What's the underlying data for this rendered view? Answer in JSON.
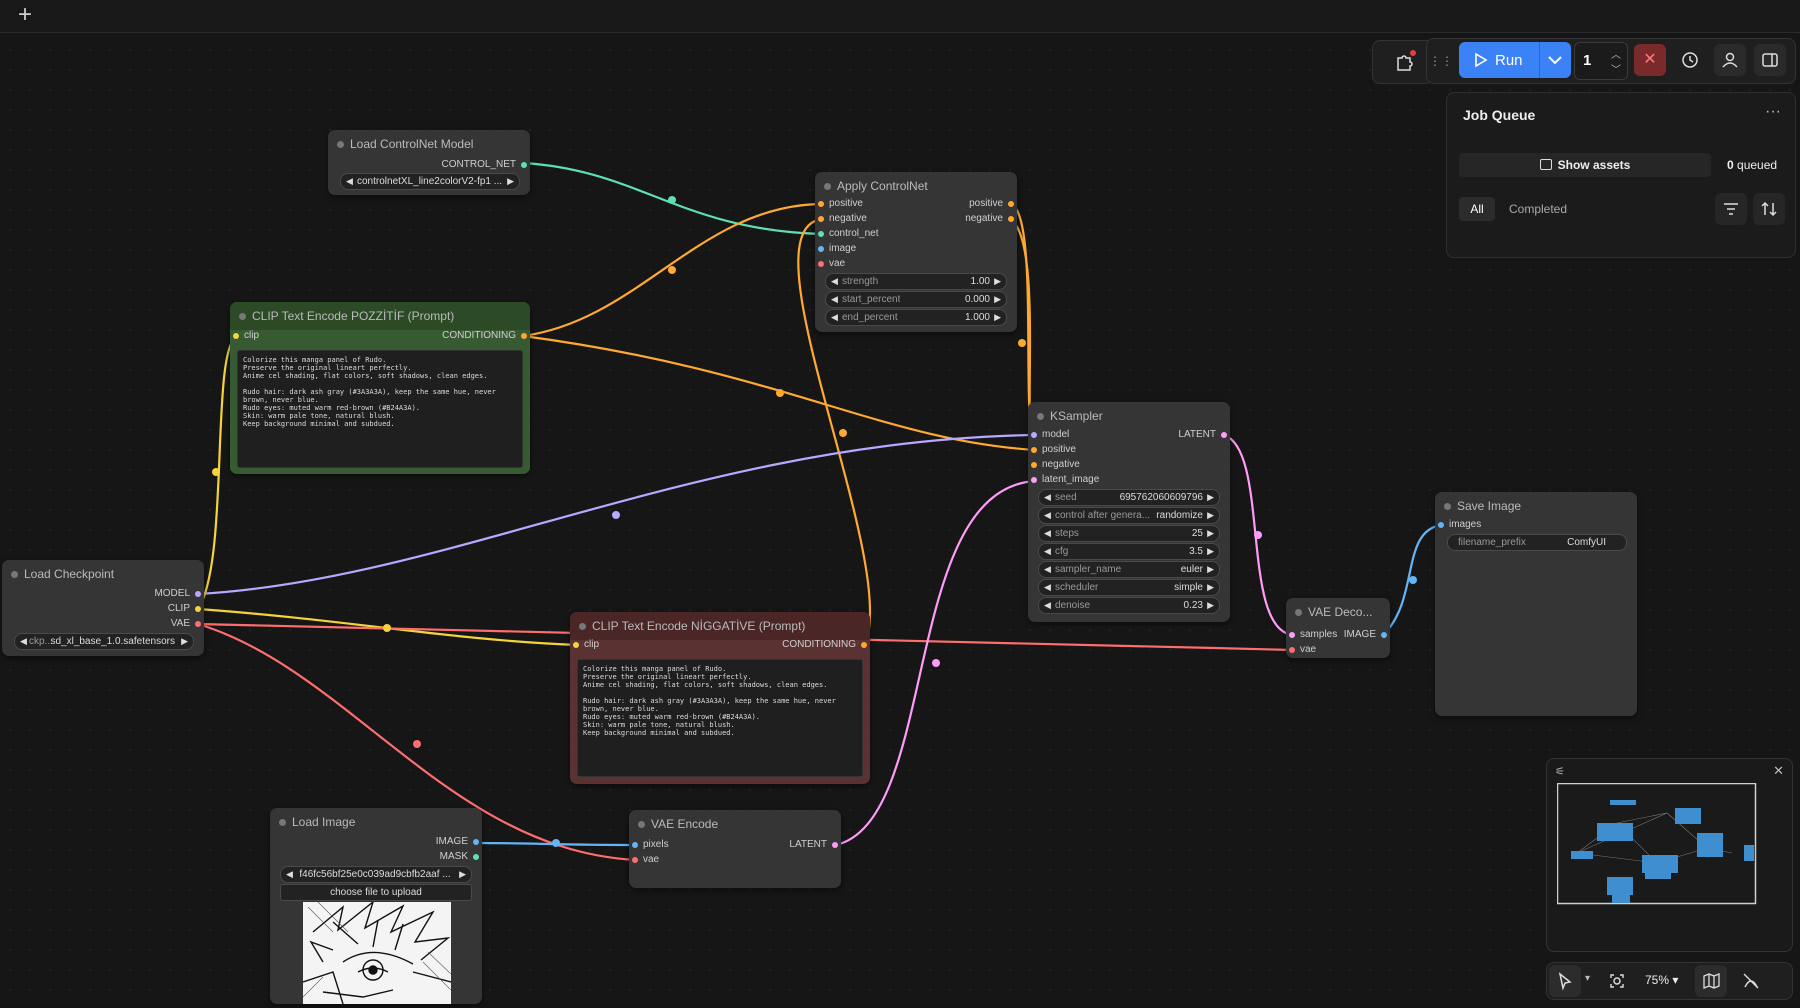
{
  "topbar": {
    "new_tab_icon": "plus-icon"
  },
  "colors": {
    "model": "#b8a8ff",
    "clip": "#f5d33b",
    "vae": "#ff6e6e",
    "conditioning": "#ffa930",
    "control_net": "#5ee0b0",
    "image": "#64b5f6",
    "latent": "#ff9cf9",
    "accent": "#3b82f6"
  },
  "nodes": {
    "load_controlnet": {
      "title": "Load ControlNet Model",
      "out_control_net": "CONTROL_NET",
      "model_name": "controlnetXL_line2colorV2-fp1 ..."
    },
    "apply_controlnet": {
      "title": "Apply ControlNet",
      "in_positive": "positive",
      "in_negative": "negative",
      "in_control_net": "control_net",
      "in_image": "image",
      "in_vae": "vae",
      "out_positive": "positive",
      "out_negative": "negative",
      "strength_label": "strength",
      "strength": "1.00",
      "start_label": "start_percent",
      "start": "0.000",
      "end_label": "end_percent",
      "end": "1.000"
    },
    "clip_pos": {
      "title": "CLIP Text Encode POZZİTİF (Prompt)",
      "in_clip": "clip",
      "out_conditioning": "CONDITIONING",
      "text": "Colorize this manga panel of Rudo.\nPreserve the original lineart perfectly.\nAnime cel shading, flat colors, soft shadows, clean edges.\n\nRudo hair: dark ash gray (#3A3A3A), keep the same hue, never\nbrown, never blue.\nRudo eyes: muted warm red-brown (#B24A3A).\nSkin: warm pale tone, natural blush.\nKeep background minimal and subdued."
    },
    "clip_neg": {
      "title": "CLIP Text Encode NİGGATİVE (Prompt)",
      "in_clip": "clip",
      "out_conditioning": "CONDITIONING",
      "text": "Colorize this manga panel of Rudo.\nPreserve the original lineart perfectly.\nAnime cel shading, flat colors, soft shadows, clean edges.\n\nRudo hair: dark ash gray (#3A3A3A), keep the same hue, never\nbrown, never blue.\nRudo eyes: muted warm red-brown (#B24A3A).\nSkin: warm pale tone, natural blush.\nKeep background minimal and subdued."
    },
    "ksampler": {
      "title": "KSampler",
      "in_model": "model",
      "in_positive": "positive",
      "in_negative": "negative",
      "in_latent": "latent_image",
      "out_latent": "LATENT",
      "seed_label": "seed",
      "seed": "695762060609796",
      "control_label": "control after genera...",
      "control": "randomize",
      "steps_label": "steps",
      "steps": "25",
      "cfg_label": "cfg",
      "cfg": "3.5",
      "sampler_label": "sampler_name",
      "sampler": "euler",
      "scheduler_label": "scheduler",
      "scheduler": "simple",
      "denoise_label": "denoise",
      "denoise": "0.23"
    },
    "save_image": {
      "title": "Save Image",
      "in_images": "images",
      "prefix_label": "filename_prefix",
      "prefix": "ComfyUI"
    },
    "vae_decode": {
      "title": "VAE Deco...",
      "in_samples": "samples",
      "in_vae": "vae",
      "out_image": "IMAGE"
    },
    "load_checkpoint": {
      "title": "Load Checkpoint",
      "out_model": "MODEL",
      "out_clip": "CLIP",
      "out_vae": "VAE",
      "ckpt_label": "ckp...",
      "ckpt": "sd_xl_base_1.0.safetensors"
    },
    "load_image": {
      "title": "Load Image",
      "out_image": "IMAGE",
      "out_mask": "MASK",
      "image_name": "f46fc56bf25e0c039ad9cbfb2aaf ...",
      "upload_label": "choose file to upload"
    },
    "vae_encode": {
      "title": "VAE Encode",
      "in_pixels": "pixels",
      "in_vae": "vae",
      "out_latent": "LATENT"
    }
  },
  "toolbar": {
    "run_label": "Run",
    "batch_count": "1"
  },
  "queue_panel": {
    "title": "Job Queue",
    "show_assets": "Show assets",
    "queued_count": "0",
    "queued_label": "queued",
    "tab_all": "All",
    "tab_completed": "Completed"
  },
  "bottom_bar": {
    "zoom": "75%"
  }
}
